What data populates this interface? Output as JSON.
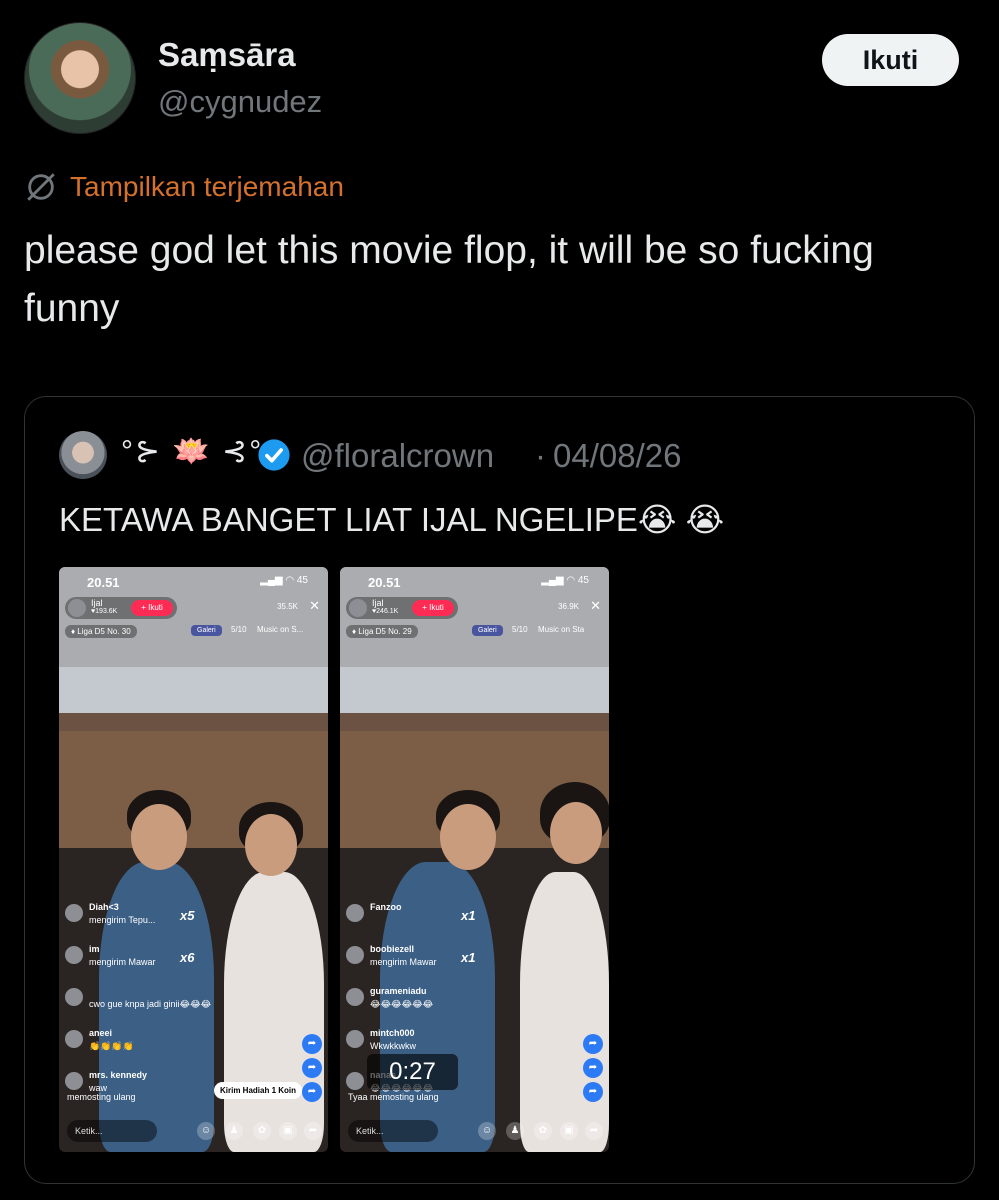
{
  "tweet": {
    "author": {
      "display_name": "Saṃsāra",
      "handle": "@cygnudez"
    },
    "follow_label": "Ikuti",
    "translate_label": "Tampilkan terjemahan",
    "text": "please god let this movie flop, it will be so fucking funny"
  },
  "quote": {
    "display_name": "°⊱ 🪷 ⊰°",
    "handle": "@floralcrown",
    "separator": "·",
    "date": "04/08/26",
    "text": "KETAWA BANGET LIAT IJAL NGELIPE😭 😭"
  },
  "media": [
    {
      "time": "20.51",
      "battery": "45",
      "host": "Ijal",
      "likes": "♥193.6K",
      "follow": "+ Ikuti",
      "viewers": "35.5K",
      "close": "✕",
      "league": "♦ Liga D5 No. 30",
      "galeri": "Galeri",
      "slots": "5/10",
      "music": "Music on S...",
      "comments": [
        {
          "user": "Diah<3",
          "msg": "mengirim Tepu...",
          "mult": "x5"
        },
        {
          "user": "im",
          "msg": "mengirim Mawar",
          "mult": "x6"
        },
        {
          "user": "",
          "msg": "cwo gue knpa jadi ginii😂😂😂"
        },
        {
          "user": "aneei",
          "msg": "👏👏👏👏"
        },
        {
          "user": "mrs. kennedy",
          "msg": "waw"
        }
      ],
      "repost": "memosting ulang",
      "gift_tooltip": "Kirim Hadiah 1 Koin",
      "input": "Ketik..."
    },
    {
      "time": "20.51",
      "battery": "45",
      "host": "Ijal",
      "likes": "♥246.1K",
      "follow": "+ Ikuti",
      "viewers": "36.9K",
      "close": "✕",
      "league": "♦ Liga D5 No. 29",
      "galeri": "Galeri",
      "slots": "5/10",
      "music": "Music on Sta",
      "comments": [
        {
          "user": "Fanzoo",
          "msg": "",
          "mult": "x1"
        },
        {
          "user": "boobiezell",
          "msg": "mengirim Mawar",
          "mult": "x1"
        },
        {
          "user": "gurameniadu",
          "msg": "😂😂😂😂😂😂"
        },
        {
          "user": "mintch000",
          "msg": "Wkwkkwkw"
        },
        {
          "user": "nanas",
          "msg": "😂😂😂😂😂😂"
        }
      ],
      "repost": "Tyaa memosting ulang",
      "input": "Ketik...",
      "duration": "0:27"
    }
  ],
  "colors": {
    "translate": "#d4712c",
    "verified": "#1d9bf0",
    "follow_pill": "#fe2c55"
  }
}
